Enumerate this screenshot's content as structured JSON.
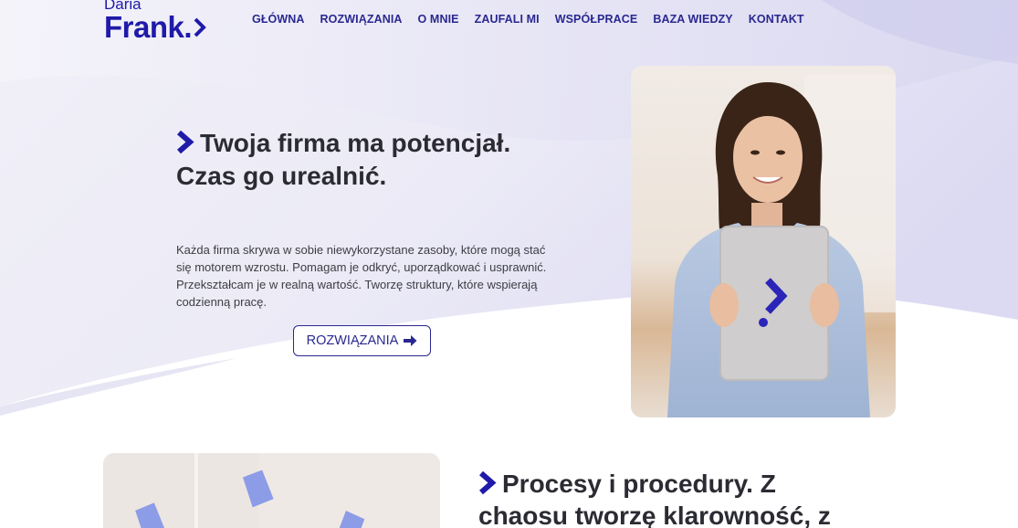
{
  "logo": {
    "first_name": "Daria",
    "last_name": "Frank."
  },
  "nav": {
    "items": [
      "GŁÓWNA",
      "ROZWIĄZANIA",
      "O MNIE",
      "ZAUFALI MI",
      "WSPÓŁPRACE",
      "BAZA WIEDZY",
      "KONTAKT"
    ]
  },
  "hero": {
    "title": "Twoja firma ma potencjał. Czas go urealnić.",
    "text": "Każda firma skrywa w sobie niewykorzystane zasoby, które mogą stać się motorem wzrostu. Pomagam je odkryć, uporządkować i usprawnić. Przekształcam je w realną wartość. Tworzę struktury, które wspierają codzienną pracę.",
    "button_label": "ROZWIĄZANIA"
  },
  "section2": {
    "title_line1": "Procesy i procedury. Z",
    "title_line2": "chaosu tworzę klarowność, z"
  },
  "colors": {
    "brand": "#1f1aa8",
    "nav": "#2a2890",
    "heading": "#2b2b33"
  },
  "icons": [
    "chevron-right-icon",
    "arrow-right-icon"
  ]
}
